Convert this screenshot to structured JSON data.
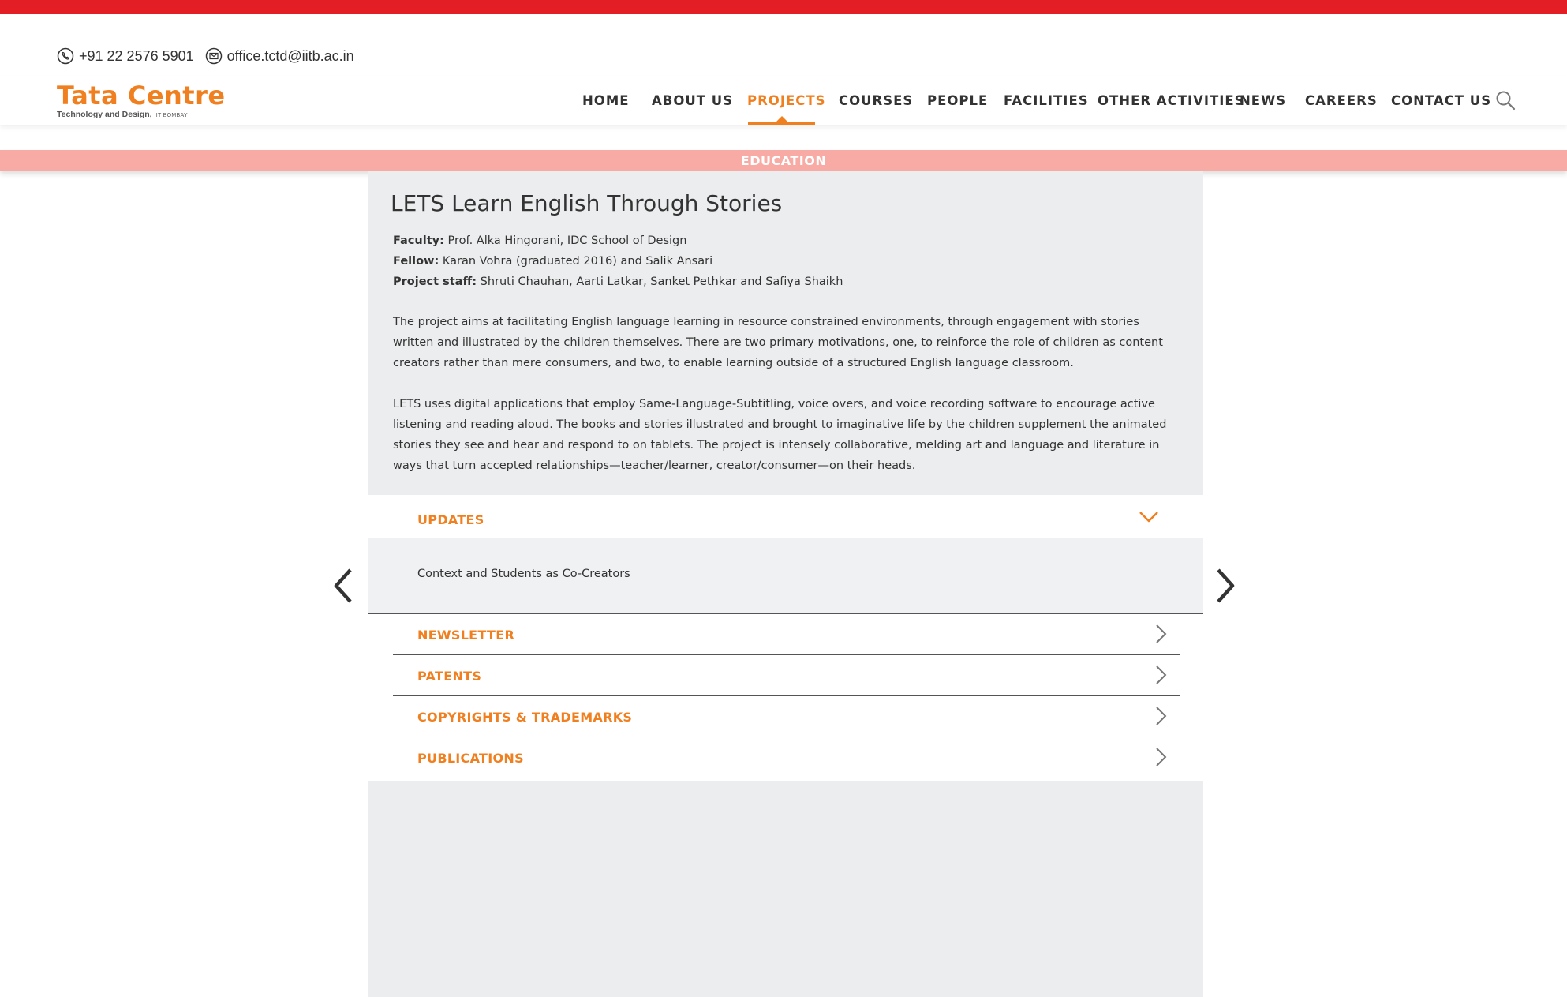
{
  "brand": {
    "top_bar_color": "#e31e24",
    "accent_color": "#f07f1f",
    "category_band_color": "#f7aba4",
    "logo_title": "Tata Centre",
    "logo_subtitle": "Technology and Design,",
    "logo_subtitle_small": "IIT BOMBAY"
  },
  "contact": {
    "phone_icon": "phone-icon",
    "phone": "+91 22 2576 5901",
    "email_icon": "envelope-icon",
    "email": "office.tctd@iitb.ac.in"
  },
  "nav": {
    "items": [
      {
        "label": "HOME",
        "active": false
      },
      {
        "label": "ABOUT US",
        "active": false
      },
      {
        "label": "PROJECTS",
        "active": true
      },
      {
        "label": "COURSES",
        "active": false
      },
      {
        "label": "PEOPLE",
        "active": false
      },
      {
        "label": "FACILITIES",
        "active": false
      },
      {
        "label": "OTHER ACTIVITIES",
        "active": false
      },
      {
        "label": "NEWS",
        "active": false
      },
      {
        "label": "CAREERS",
        "active": false
      },
      {
        "label": "CONTACT US",
        "active": false
      }
    ],
    "search_icon": "search-icon"
  },
  "category": "EDUCATION",
  "project": {
    "title": "LETS Learn English Through Stories",
    "faculty_label": "Faculty:",
    "faculty": " Prof. Alka Hingorani, IDC School of Design",
    "fellow_label": "Fellow:",
    "fellow": " Karan Vohra (graduated 2016) and Salik Ansari",
    "staff_label": "Project staff:",
    "staff": " Shruti Chauhan, Aarti Latkar, Sanket Pethkar and Safiya Shaikh",
    "paragraph_1": "The project aims at facilitating English language learning in resource constrained environments, through engagement with stories written and illustrated by the children themselves. There are two primary motivations, one, to reinforce the role of children as content creators rather than mere consumers, and two, to enable learning outside of a structured English language classroom.",
    "paragraph_2": "LETS uses digital applications that employ Same-Language-Subtitling, voice overs, and voice recording software to encourage active listening and reading aloud. The books and stories illustrated and brought to imaginative life by the children supplement the animated stories they see and hear and respond to on tablets. The project is intensely collaborative, melding art and language and literature in ways that turn accepted relationships—teacher/learner, creator/consumer—on their heads."
  },
  "accordion": {
    "updates_label": "UPDATES",
    "updates_expanded": true,
    "updates_items": [
      "Context and Students as Co-Creators"
    ],
    "sections": [
      {
        "label": "NEWSLETTER"
      },
      {
        "label": "PATENTS"
      },
      {
        "label": "COPYRIGHTS & TRADEMARKS"
      },
      {
        "label": "PUBLICATIONS"
      }
    ]
  },
  "slider": {
    "prev_icon": "chevron-left-icon",
    "next_icon": "chevron-right-icon"
  }
}
